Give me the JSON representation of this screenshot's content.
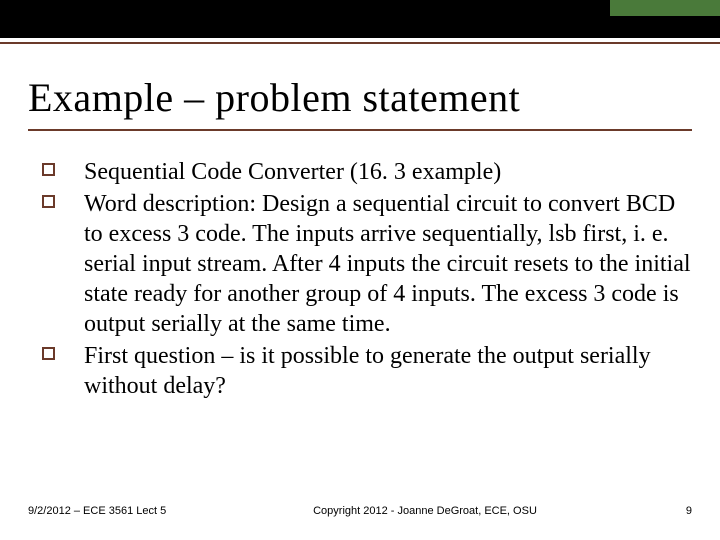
{
  "header": {
    "title": "Example – problem statement"
  },
  "bullets": [
    "Sequential Code Converter (16. 3 example)",
    "Word description: Design a sequential circuit to convert BCD to excess 3 code. The inputs arrive sequentially, lsb first, i. e. serial input stream.  After 4 inputs the circuit resets to the initial state ready for another group of 4 inputs.  The excess 3 code is output serially at the same time.",
    "First question – is it possible to generate the output serially without delay?"
  ],
  "footer": {
    "left": "9/2/2012 – ECE 3561 Lect 5",
    "center": "Copyright 2012 - Joanne DeGroat, ECE, OSU",
    "right": "9"
  },
  "colors": {
    "accent_green": "#4a7a3a",
    "rule_brown": "#6b3a2a"
  }
}
